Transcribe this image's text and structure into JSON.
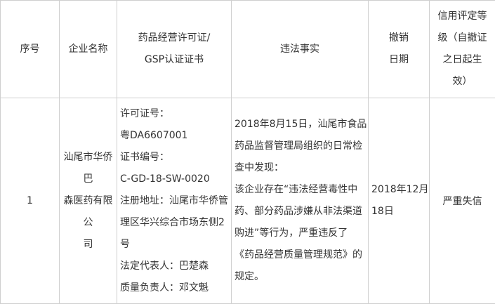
{
  "headers": {
    "index": "序号",
    "company": "企业名称",
    "license_lines": [
      "药品经营许可证/",
      "GSP认证证书"
    ],
    "violation": "违法事实",
    "revoke_lines": [
      "撤销",
      "日期"
    ],
    "credit_lines": [
      "信用评定等",
      "级（自撤证",
      "之日起生",
      "效）"
    ]
  },
  "row": {
    "index": "1",
    "company_lines": [
      "汕尾市华侨巴",
      "森医药有限公",
      "司"
    ],
    "license_lines": [
      "许可证号：",
      "粤DA6607001",
      "证书编号：",
      "C-GD-18-SW-0020",
      "注册地址：汕尾市华侨管",
      "理区华兴综合市场东侧2",
      "号",
      "法定代表人：巴楚森",
      "质量负责人：邓文魁"
    ],
    "violation_lines": [
      "2018年8月15日，汕尾市食品",
      "药品监督管理局组织的日常检",
      "查中发现：",
      "该企业存在“违法经营毒性中",
      "药、部分药品涉嫌从非法渠道",
      "购进”等行为，严重违反了",
      "《药品经营质量管理规范》的",
      "规定。"
    ],
    "revoke_lines": [
      "2018年12月",
      "18日"
    ],
    "credit": "严重失信"
  }
}
